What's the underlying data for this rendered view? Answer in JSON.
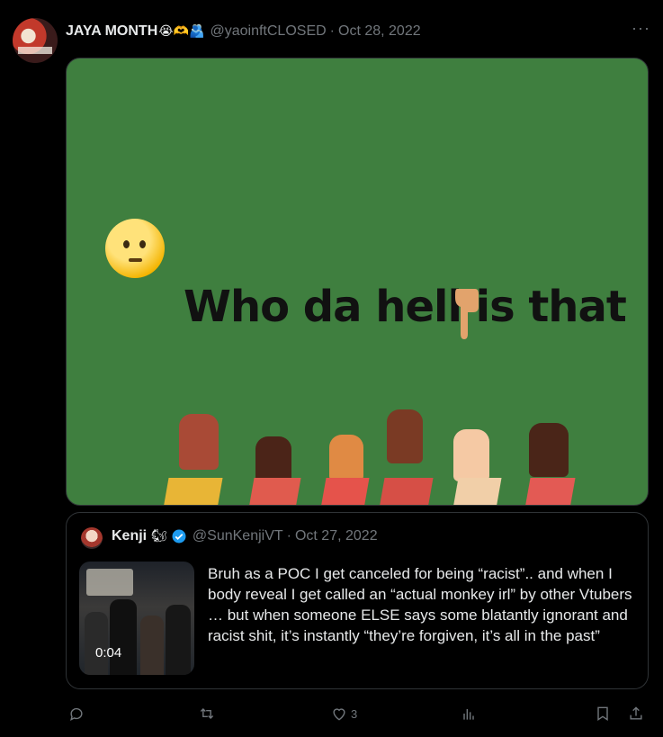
{
  "tweet": {
    "author_name": "JAYA MONTH",
    "author_emojis": "😭🫶🫂",
    "handle": "@yaoinftCLOSED",
    "separator": "·",
    "date": "Oct 28, 2022",
    "more_label": "···",
    "media": {
      "caption": "Who da hell is that"
    }
  },
  "quoted": {
    "author_name": "Kenji",
    "author_emoji": "🐿",
    "handle": "@SunKenjiVT",
    "separator": "·",
    "date": "Oct 27, 2022",
    "video_duration": "0:04",
    "text": "Bruh as a POC I get canceled for being “racist”.. and when I body reveal I get called an “actual monkey irl” by other Vtubers … but when someone ELSE says some blatantly ignorant and racist shit, it’s instantly “they’re forgiven, it’s all in the past”"
  },
  "actions": {
    "reply_icon": "reply-icon",
    "retweet_icon": "retweet-icon",
    "like_icon": "heart-icon",
    "like_count": "3",
    "views_icon": "views-icon",
    "bookmark_icon": "bookmark-icon",
    "share_icon": "share-icon"
  },
  "colors": {
    "background": "#000000",
    "text": "#e7e9ea",
    "muted": "#71767b",
    "border": "#2f3336",
    "meme_green": "#3f7f3f",
    "verified": "#1d9bf0"
  }
}
